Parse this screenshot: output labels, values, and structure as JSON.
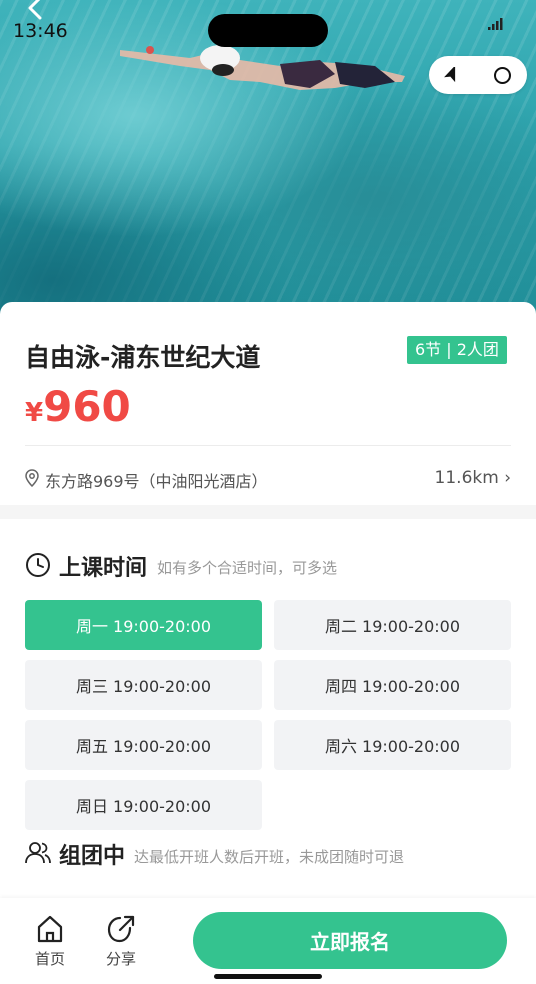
{
  "status_bar": {
    "time": "13:46"
  },
  "course": {
    "title": "自由泳-浦东世纪大道",
    "tag": "6节 | 2人团",
    "price_currency": "¥",
    "price": "960",
    "address": "东方路969号（中油阳光酒店）",
    "distance": "11.6km ›"
  },
  "schedule": {
    "title": "上课时间",
    "hint": "如有多个合适时间，可多选",
    "slots": [
      {
        "label": "周一 19:00-20:00",
        "selected": true
      },
      {
        "label": "周二 19:00-20:00",
        "selected": false
      },
      {
        "label": "周三 19:00-20:00",
        "selected": false
      },
      {
        "label": "周四 19:00-20:00",
        "selected": false
      },
      {
        "label": "周五 19:00-20:00",
        "selected": false
      },
      {
        "label": "周六 19:00-20:00",
        "selected": false
      },
      {
        "label": "周日 19:00-20:00",
        "selected": false
      }
    ]
  },
  "group": {
    "title": "组团中",
    "hint": "达最低开班人数后开班，未成团随时可退"
  },
  "bottom_bar": {
    "home_label": "首页",
    "share_label": "分享",
    "cta_label": "立即报名"
  },
  "colors": {
    "accent": "#34c38f",
    "price": "#f04a45",
    "slot_bg": "#f2f3f5"
  },
  "icons": {
    "back": "chevron-left-icon",
    "signal": "signal-icon",
    "capsule_left": "location-arrow-icon",
    "capsule_right": "circle-icon",
    "location": "map-pin-icon",
    "schedule": "clock-icon",
    "group": "users-icon",
    "home": "home-icon",
    "share": "share-icon"
  }
}
